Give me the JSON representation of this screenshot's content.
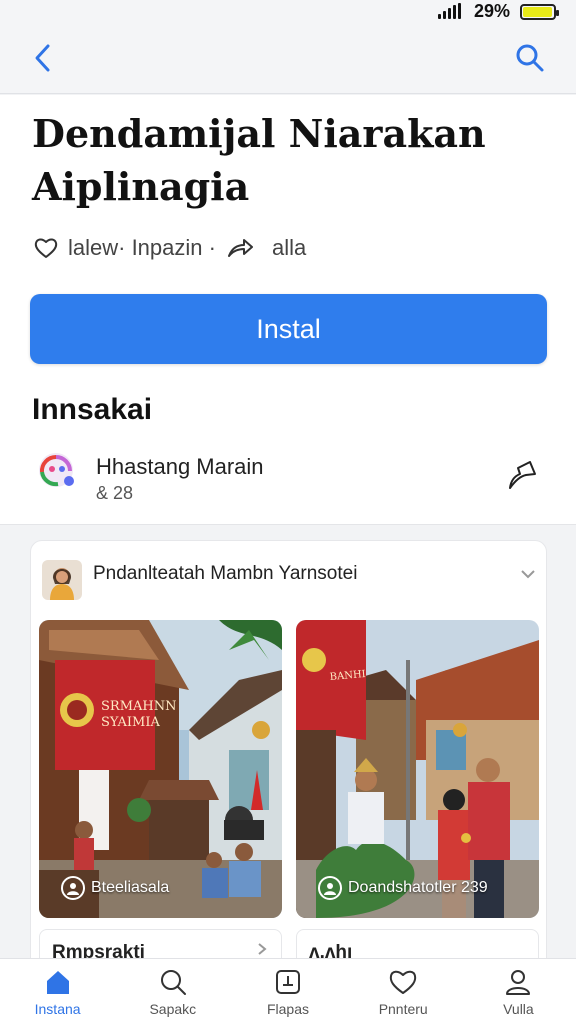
{
  "status": {
    "battery_percent": "29%",
    "battery_level": 0.9
  },
  "header": {
    "title": "Dendamijal Niarakan Aiplinagia",
    "meta_text": "lalew· Inpazin ·",
    "share_text": "alla",
    "install_label": "Instal",
    "section_title": "Innsakai"
  },
  "account": {
    "name": "Hhastang Marain",
    "count": "& 28"
  },
  "post": {
    "author": "Pndanlteatah Mambn Yarnsotei",
    "photos": [
      {
        "caption": "Bteeliasala",
        "banner": "SRMAHNN SYAIMIA"
      },
      {
        "caption": "Doandshatotler 239"
      }
    ],
    "sub_cards": [
      "Rmpsrakti",
      "ʌ.ʌhı"
    ]
  },
  "tabs": [
    {
      "label": "Instana",
      "icon": "home-icon"
    },
    {
      "label": "Sapakc",
      "icon": "search-icon"
    },
    {
      "label": "Flapas",
      "icon": "add-box-icon"
    },
    {
      "label": "Pnnteru",
      "icon": "heart-icon"
    },
    {
      "label": "Vulla",
      "icon": "profile-icon"
    }
  ],
  "colors": {
    "accent": "#2f7ded",
    "active_tab": "#2f74e6"
  }
}
